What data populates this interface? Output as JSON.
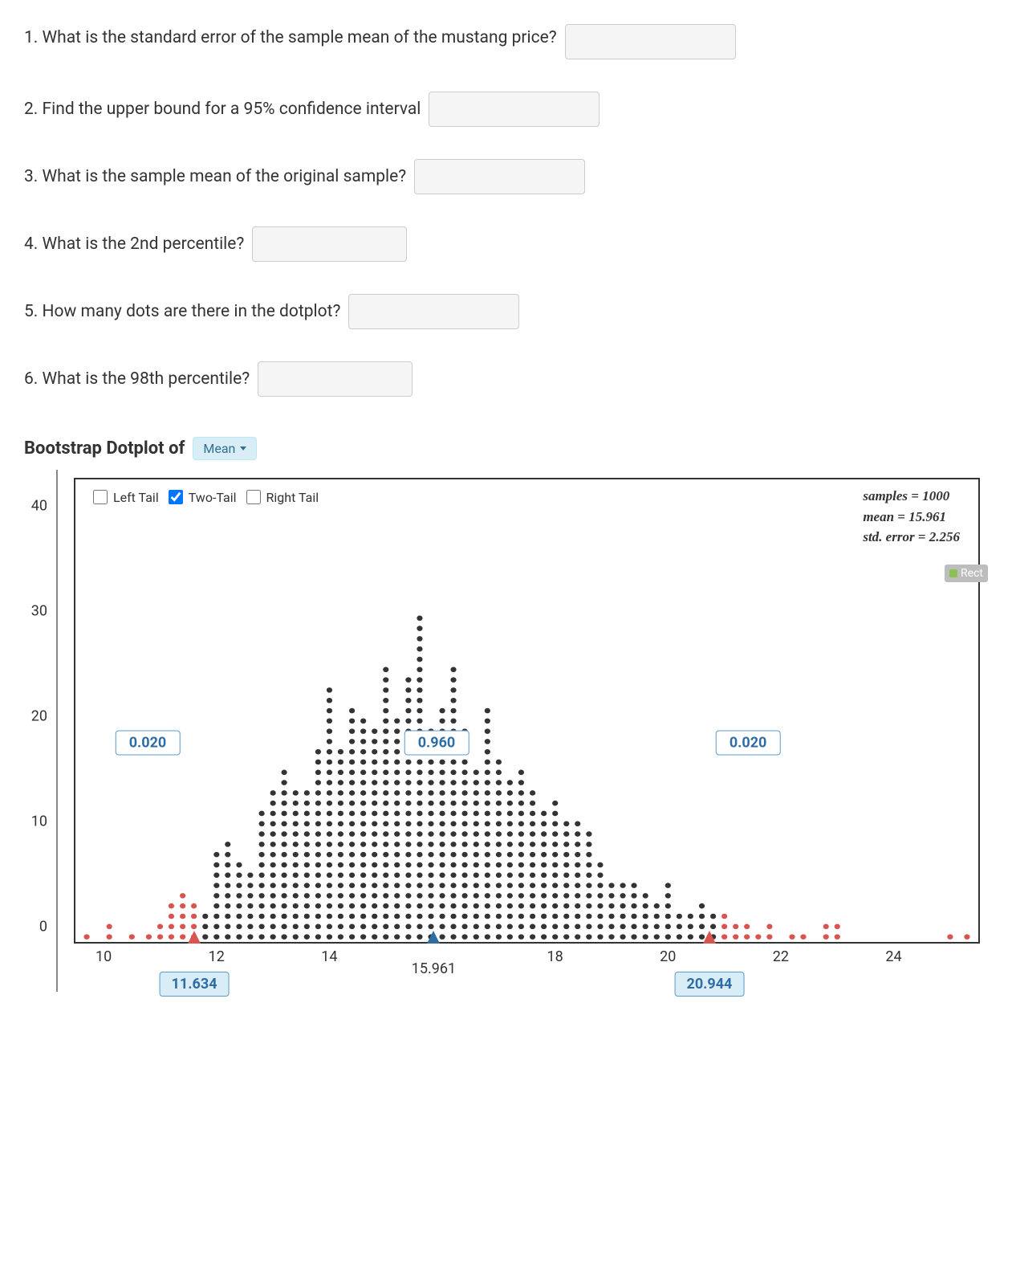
{
  "questions": {
    "q1": "1. What is the standard error of the sample mean of the mustang price?",
    "q2": "2. Find the upper bound for a 95% confidence interval",
    "q3": "3. What is the sample mean of the original sample?",
    "q4": "4. What is the 2nd percentile?",
    "q5": "5. How many dots are there in the dotplot?",
    "q6": "6. What is the 98th percentile?"
  },
  "dotplot": {
    "title_prefix": "Bootstrap Dotplot of",
    "dropdown_value": "Mean",
    "tails": {
      "left_label": "Left Tail",
      "two_label": "Two-Tail",
      "right_label": "Right Tail",
      "left_checked": false,
      "two_checked": true,
      "right_checked": false
    },
    "stats": {
      "samples_label": "samples = 1000",
      "mean_label": "mean = 15.961",
      "stderr_label": "std. error = 2.256"
    },
    "proportions": {
      "left": "0.020",
      "center": "0.960",
      "right": "0.020"
    },
    "markers": {
      "left_x": "12",
      "left_value": "11.634",
      "center_value": "15.961",
      "right_value": "20.944"
    },
    "rect_badge": "Rect"
  },
  "chart_data": {
    "type": "dotplot",
    "title": "Bootstrap Dotplot of Mean",
    "xlabel": "",
    "ylabel": "",
    "x_ticks": [
      10,
      12,
      14,
      16,
      18,
      20,
      22,
      24
    ],
    "y_ticks": [
      0,
      10,
      20,
      30,
      40
    ],
    "xlim": [
      9.5,
      25.5
    ],
    "ylim": [
      0,
      45
    ],
    "samples": 1000,
    "mean": 15.961,
    "std_error": 2.256,
    "two_tail_cutoffs": [
      11.634,
      20.944
    ],
    "tail_proportions": {
      "left": 0.02,
      "center": 0.96,
      "right": 0.02
    },
    "bins": [
      {
        "x": 9.7,
        "count": 1
      },
      {
        "x": 10.1,
        "count": 2
      },
      {
        "x": 10.5,
        "count": 1
      },
      {
        "x": 10.8,
        "count": 1
      },
      {
        "x": 11.0,
        "count": 2
      },
      {
        "x": 11.2,
        "count": 4
      },
      {
        "x": 11.4,
        "count": 5
      },
      {
        "x": 11.6,
        "count": 4
      },
      {
        "x": 11.8,
        "count": 3
      },
      {
        "x": 12.0,
        "count": 9
      },
      {
        "x": 12.2,
        "count": 10
      },
      {
        "x": 12.4,
        "count": 8
      },
      {
        "x": 12.6,
        "count": 7
      },
      {
        "x": 12.8,
        "count": 13
      },
      {
        "x": 13.0,
        "count": 15
      },
      {
        "x": 13.2,
        "count": 17
      },
      {
        "x": 13.4,
        "count": 15
      },
      {
        "x": 13.6,
        "count": 15
      },
      {
        "x": 13.8,
        "count": 19
      },
      {
        "x": 14.0,
        "count": 25
      },
      {
        "x": 14.2,
        "count": 19
      },
      {
        "x": 14.4,
        "count": 23
      },
      {
        "x": 14.6,
        "count": 22
      },
      {
        "x": 14.8,
        "count": 21
      },
      {
        "x": 15.0,
        "count": 27
      },
      {
        "x": 15.2,
        "count": 22
      },
      {
        "x": 15.4,
        "count": 26
      },
      {
        "x": 15.6,
        "count": 32
      },
      {
        "x": 15.8,
        "count": 21
      },
      {
        "x": 16.0,
        "count": 23
      },
      {
        "x": 16.2,
        "count": 27
      },
      {
        "x": 16.4,
        "count": 21
      },
      {
        "x": 16.6,
        "count": 17
      },
      {
        "x": 16.8,
        "count": 23
      },
      {
        "x": 17.0,
        "count": 18
      },
      {
        "x": 17.2,
        "count": 16
      },
      {
        "x": 17.4,
        "count": 17
      },
      {
        "x": 17.6,
        "count": 15
      },
      {
        "x": 17.8,
        "count": 13
      },
      {
        "x": 18.0,
        "count": 14
      },
      {
        "x": 18.2,
        "count": 12
      },
      {
        "x": 18.4,
        "count": 12
      },
      {
        "x": 18.6,
        "count": 11
      },
      {
        "x": 18.8,
        "count": 8
      },
      {
        "x": 19.0,
        "count": 6
      },
      {
        "x": 19.2,
        "count": 6
      },
      {
        "x": 19.4,
        "count": 6
      },
      {
        "x": 19.6,
        "count": 5
      },
      {
        "x": 19.8,
        "count": 4
      },
      {
        "x": 20.0,
        "count": 6
      },
      {
        "x": 20.2,
        "count": 3
      },
      {
        "x": 20.4,
        "count": 3
      },
      {
        "x": 20.6,
        "count": 4
      },
      {
        "x": 20.8,
        "count": 3
      },
      {
        "x": 21.0,
        "count": 3
      },
      {
        "x": 21.2,
        "count": 2
      },
      {
        "x": 21.4,
        "count": 2
      },
      {
        "x": 21.6,
        "count": 1
      },
      {
        "x": 21.8,
        "count": 2
      },
      {
        "x": 22.2,
        "count": 1
      },
      {
        "x": 22.4,
        "count": 1
      },
      {
        "x": 22.8,
        "count": 2
      },
      {
        "x": 23.0,
        "count": 2
      },
      {
        "x": 25.0,
        "count": 1
      },
      {
        "x": 25.3,
        "count": 1
      }
    ]
  }
}
